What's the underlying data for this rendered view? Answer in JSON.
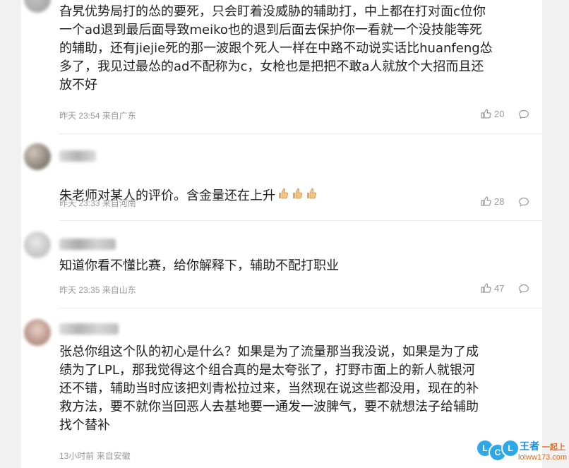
{
  "comments": [
    {
      "text": "旮旯优势局打的怂的要死，只会盯着没威胁的辅助打，中上都在打对面c位你\n一个ad退到最后面导致meiko也的退到后面去保护你一看就一个没技能等死\n的辅助，还有jiejie死的那一波跟个死人一样在中路不动说实话比huanfeng怂\n多了，我见过最怂的ad不配称为c，女枪也是把把不敢a人就放个大招而且还\n放不好",
      "time": "昨天 23:54",
      "location": "来自广东",
      "likes": "20"
    },
    {
      "text": "朱老师对某人的评价。含金量还在上升",
      "emoji_icon": "thumbs-up-icon",
      "emoji_count": 3,
      "time": "昨天 23:33",
      "location": "来自河南",
      "likes": "28"
    },
    {
      "text": "知道你看不懂比赛，给你解释下，辅助不配打职业",
      "time": "昨天 23:35",
      "location": "来自山东",
      "likes": "47"
    },
    {
      "text": "张总你组这个队的初心是什么？如果是为了流量那当我没说，如果是为了成\n绩为了LPL，那我觉得这个组合真的是太夸张了，打野市面上的新人就银河\n还不错，辅助当时应该把刘青松拉过来，当然现在说这些都没用，现在的补\n救方法，要不就你当回恶人去基地要一通发一波脾气，要不就想法子给辅助\n找个替补",
      "time": "13小时前",
      "location": "来自安徽"
    }
  ],
  "watermark": {
    "letters": [
      "L",
      "C",
      "L"
    ],
    "brand": "王者",
    "brand_suffix": "一起上",
    "url": "lolww173.com"
  },
  "colors": {
    "text": "#222222",
    "meta": "#999999",
    "watermark_blue": "#2fa8e8",
    "watermark_orange": "#e86a1c"
  }
}
